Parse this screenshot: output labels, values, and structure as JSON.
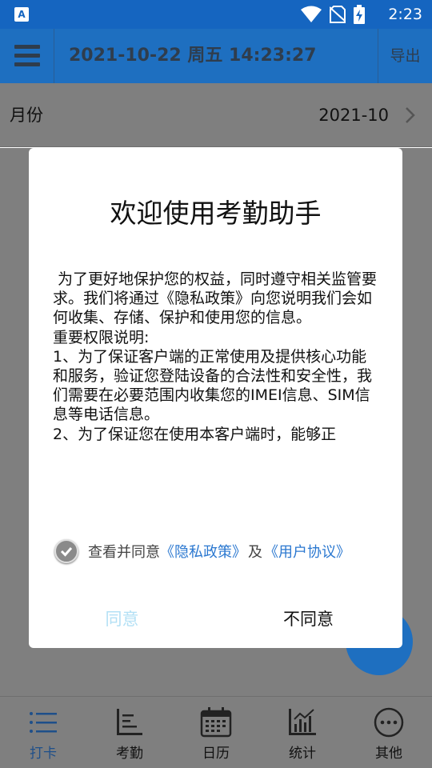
{
  "status_bar": {
    "app_icon_letter": "A",
    "time": "2:23",
    "icons": [
      "wifi-icon",
      "no-sim-icon",
      "battery-charging-icon"
    ]
  },
  "header": {
    "datetime": "2021-10-22 周五 14:23:27",
    "export_label": "导出",
    "menu_icon": "menu-icon"
  },
  "month_row": {
    "label": "月份",
    "value": "2021-10"
  },
  "dialog": {
    "title": "欢迎使用考勤助手",
    "paragraphs": [
      " 为了更好地保护您的权益，同时遵守相关监管要求。我们将通过《隐私政策》向您说明我们会如何收集、存储、保护和使用您的信息。",
      "重要权限说明:",
      "1、为了保证客户端的正常使用及提供核心功能和服务，验证您登陆设备的合法性和安全性，我们需要在必要范围内收集您的IMEI信息、SIM信息等电话信息。",
      "2、为了保证您在使用本客户端时，能够正"
    ],
    "agree_prefix": "查看并同意",
    "privacy_link": "《隐私政策》",
    "conjunction": "及",
    "agreement_link": "《用户协议》",
    "agree_button": "同意",
    "disagree_button": "不同意"
  },
  "bottom_nav": {
    "items": [
      {
        "label": "打卡",
        "icon": "list-icon",
        "active": true
      },
      {
        "label": "考勤",
        "icon": "bar-list-icon",
        "active": false
      },
      {
        "label": "日历",
        "icon": "calendar-icon",
        "active": false
      },
      {
        "label": "统计",
        "icon": "chart-icon",
        "active": false
      },
      {
        "label": "其他",
        "icon": "more-icon",
        "active": false
      }
    ]
  },
  "colors": {
    "header_blue": "#1e6fc0",
    "link_blue": "#2b78d0",
    "agree_disabled": "#b3e0f5",
    "dim_gray": "#7f7f7f",
    "active_nav": "#1e4f8a"
  }
}
